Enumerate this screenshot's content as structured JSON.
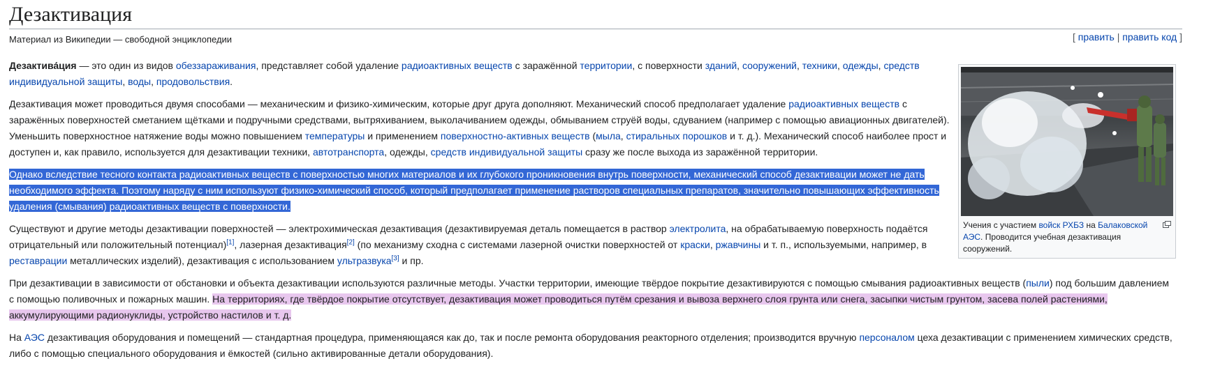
{
  "title": "Дезактивация",
  "tagline": "Материал из Википедии — свободной энциклопедии",
  "edit": {
    "bracket_open": "[ ",
    "edit": "править",
    "sep": " | ",
    "edit_code": "править код",
    "bracket_close": " ]"
  },
  "p1": {
    "bold": "Дезактива́ция",
    "t1": " — это один из видов ",
    "l1": "обеззараживания",
    "t2": ", представляет собой удаление ",
    "l2": "радиоактивных веществ",
    "t3": " с заражённой ",
    "l3": "территории",
    "t4": ", с поверхности ",
    "l4": "зданий",
    "t5": ", ",
    "l5": "сооружений",
    "t6": ", ",
    "l6": "техники",
    "t7": ", ",
    "l7": "одежды",
    "t8": ", ",
    "l8": "средств индивидуальной защиты",
    "t9": ", ",
    "l9": "воды",
    "t10": ", ",
    "l10": "продовольствия",
    "t11": "."
  },
  "p2": {
    "t1": "Дезактивация может проводиться двумя способами — механическим и физико-химическим, которые друг друга дополняют. Механический способ предполагает удаление ",
    "l1": "радиоактивных веществ",
    "t2": " с заражённых поверхностей сметанием щётками и подручными средствами, вытряхиванием, выколачиванием одежды, обмыванием струёй воды, сдуванием (например с помощью авиационных двигателей). Уменьшить поверхностное натяжение воды можно повышением ",
    "l2": "температуры",
    "t3": " и применением ",
    "l3": "поверхностно-активных веществ",
    "t4": " (",
    "l4": "мыла",
    "t5": ", ",
    "l5": "стиральных порошков",
    "t6": " и т. д.). Механический способ наиболее прост и доступен и, как правило, используется для дезактивации техники, ",
    "l6": "автотранспорта",
    "t7": ", одежды, ",
    "l7": "средств индивидуальной защиты",
    "t8": " сразу же после выхода из заражённой территории."
  },
  "p3": {
    "text": "Однако вследствие тесного контакта радиоактивных веществ с поверхностью многих материалов и их глубокого проникновения внутрь поверхности, механический способ дезактивации может не дать необходимого эффекта. Поэтому наряду с ним используют физико-химический способ, который предполагает применение растворов специальных препаратов, значительно повышающих эффективность удаления (смывания) радиоактивных веществ с поверхности."
  },
  "p4": {
    "t1": "Существуют и другие методы дезактивации поверхностей — электрохимическая дезактивация (дезактивируемая деталь помещается в раствор ",
    "l1": "электролита",
    "t2": ", на обрабатываемую поверхность подаётся отрицательный или положительный потенциал)",
    "r1": "[1]",
    "t3": ", лазерная дезактивация",
    "r2": "[2]",
    "t4": " (по механизму сходна с системами лазерной очистки поверхностей от ",
    "l2": "краски",
    "t5": ", ",
    "l3": "ржавчины",
    "t6": " и т. п., используемыми, например, в ",
    "l4": "реставрации",
    "t7": " металлических изделий), дезактивация с использованием ",
    "l5": "ультразвука",
    "r3": "[3]",
    "t8": " и пр."
  },
  "p5": {
    "t1": "При дезактивации в зависимости от обстановки и объекта дезактивации используются различные методы. Участки территории, имеющие твёрдое покрытие дезактивируются с помощью смывания радиоактивных веществ (",
    "l1": "пыли",
    "t2": ") под большим давлением с помощью поливочных и пожарных машин. ",
    "hl": "На территориях, где твёрдое покрытие отсутствует, дезактивация может проводиться путём срезания и вывоза верхнего слоя грунта или снега, засыпки чистым грунтом, засева полей растениями, аккумулирующими радионуклиды, устройство настилов и т. д."
  },
  "p6": {
    "t1": "На ",
    "l1": "АЭС",
    "t2": " дезактивация оборудования и помещений — стандартная процедура, применяющаяся как до, так и после ремонта оборудования реакторного отделения; производится вручную ",
    "l2": "персоналом",
    "t3": " цеха дезактивации с применением химических средств, либо с помощью специального оборудования и ёмкостей (сильно активированные детали оборудования)."
  },
  "thumb": {
    "c1": "Учения с участием ",
    "l1": "войск РХБЗ",
    "c2": " на ",
    "l2": "Балаковской АЭС",
    "c3": ". Проводится учебная дезактивация сооружений."
  },
  "colors": {
    "link": "#0645ad",
    "selection": "#3367d6",
    "highlight": "#e8c7ee"
  }
}
